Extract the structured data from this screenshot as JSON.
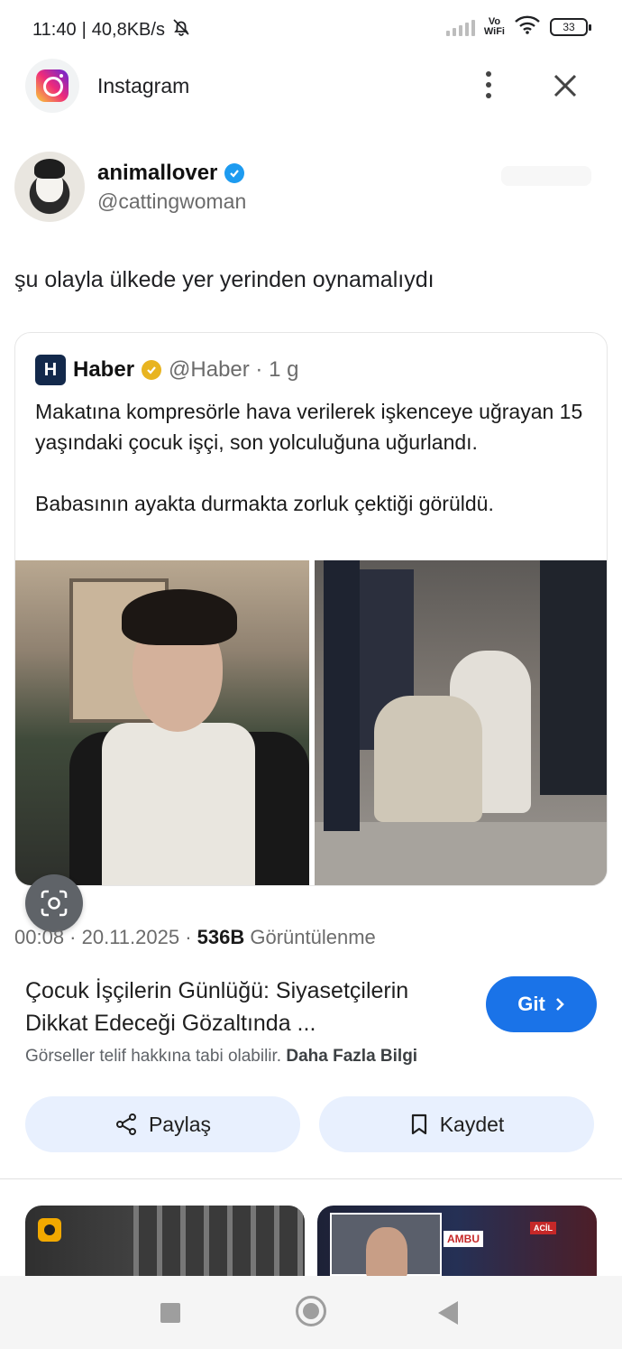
{
  "status_bar": {
    "time": "11:40",
    "speed": "40,8KB/s",
    "vowifi_top": "Vo",
    "vowifi_bottom": "WiFi",
    "battery": "33"
  },
  "app_header": {
    "title": "Instagram"
  },
  "tweet": {
    "display_name": "animallover",
    "handle": "@cattingwoman",
    "text": "şu olayla ülkede yer yerinden oynamalıydı",
    "quoted": {
      "logo_letter": "H",
      "name": "Haber",
      "handle": "@Haber · 1 g",
      "paragraph1": "Makatına kompresörle hava verilerek işkenceye uğrayan 15 yaşındaki çocuk işçi, son yolculuğuna uğurlandı.",
      "paragraph2": "Babasının ayakta durmakta zorluk çektiği görüldü."
    },
    "meta_prefix": "00:08 · 20.11.2025 ·",
    "views_count": "536B",
    "views_label": "Görüntülenme"
  },
  "result": {
    "title": "Çocuk İşçilerin Günlüğü: Siyasetçilerin Dikkat Edeceği Gözaltında ...",
    "go_button": "Git",
    "copyright_text": "Görseller telif hakkına tabi olabilir.",
    "more_info_link": "Daha Fazla Bilgi",
    "share_button": "Paylaş",
    "save_button": "Kaydet"
  },
  "thumbs": {
    "ambulance_text": "AMBU",
    "emergency_text": "ACİL"
  },
  "colors": {
    "accent": "#1a73e8",
    "action_bg": "#e8f0fe",
    "verified_blue": "#1d9bf0",
    "verified_gold": "#e8b420"
  }
}
